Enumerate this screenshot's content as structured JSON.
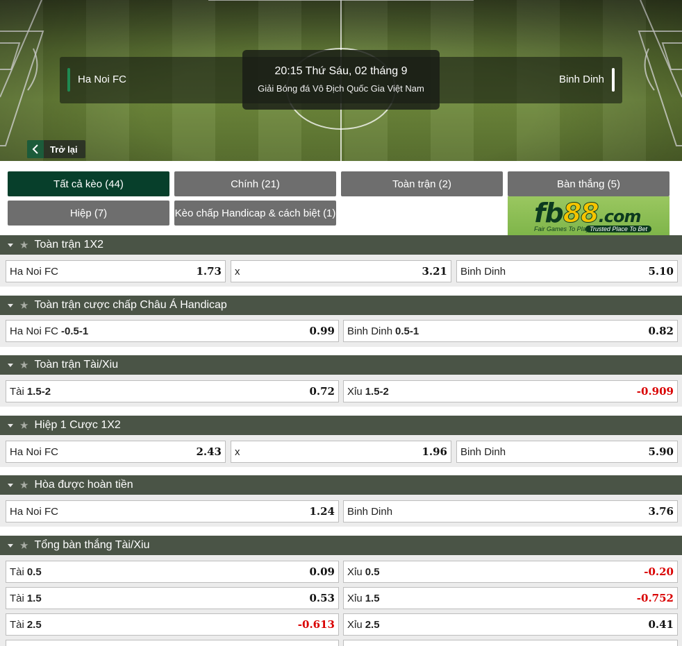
{
  "match": {
    "home_team": "Ha Noi FC",
    "away_team": "Binh Dinh",
    "datetime": "20:15 Thứ Sáu, 02 tháng 9",
    "league": "Giải Bóng đá Vô Địch Quốc Gia Việt Nam",
    "back_label": "Trở lại"
  },
  "filters": [
    {
      "label": "Tất cả kèo (44)",
      "active": true
    },
    {
      "label": "Chính (21)",
      "active": false
    },
    {
      "label": "Toàn trận (2)",
      "active": false
    },
    {
      "label": "Bàn thắng (5)",
      "active": false
    },
    {
      "label": "Hiệp (7)",
      "active": false
    },
    {
      "label": "Kèo chấp Handicap & cách biệt (1)",
      "active": false
    }
  ],
  "ad": {
    "brand_a": "fb",
    "brand_b": "88",
    "brand_c": ".com",
    "tagline_a": "Fair Games To Play",
    "tagline_b": "Trusted Place To Bet"
  },
  "markets": [
    {
      "title": "Toàn trận 1X2",
      "rows": [
        [
          {
            "label": "Ha Noi FC",
            "line": "",
            "odd": "1.73"
          },
          {
            "label": "x",
            "line": "",
            "odd": "3.21"
          },
          {
            "label": "Binh Dinh",
            "line": "",
            "odd": "5.10"
          }
        ]
      ]
    },
    {
      "title": "Toàn trận cược chấp Châu Á Handicap",
      "rows": [
        [
          {
            "label": "Ha Noi FC",
            "line": "-0.5-1",
            "odd": "0.99"
          },
          {
            "label": "Binh Dinh",
            "line": "0.5-1",
            "odd": "0.82"
          }
        ]
      ]
    },
    {
      "title": "Toàn trận Tài/Xiu",
      "rows": [
        [
          {
            "label": "Tài",
            "line": "1.5-2",
            "odd": "0.72"
          },
          {
            "label": "Xỉu",
            "line": "1.5-2",
            "odd": "-0.909"
          }
        ]
      ]
    },
    {
      "title": "Hiệp 1 Cược 1X2",
      "rows": [
        [
          {
            "label": "Ha Noi FC",
            "line": "",
            "odd": "2.43"
          },
          {
            "label": "x",
            "line": "",
            "odd": "1.96"
          },
          {
            "label": "Binh Dinh",
            "line": "",
            "odd": "5.90"
          }
        ]
      ]
    },
    {
      "title": "Hòa được hoàn tiền",
      "rows": [
        [
          {
            "label": "Ha Noi FC",
            "line": "",
            "odd": "1.24"
          },
          {
            "label": "Binh Dinh",
            "line": "",
            "odd": "3.76"
          }
        ]
      ]
    },
    {
      "title": "Tổng bàn thắng Tài/Xiu",
      "rows": [
        [
          {
            "label": "Tài",
            "line": "0.5",
            "odd": "0.09"
          },
          {
            "label": "Xỉu",
            "line": "0.5",
            "odd": "-0.20"
          }
        ],
        [
          {
            "label": "Tài",
            "line": "1.5",
            "odd": "0.53"
          },
          {
            "label": "Xỉu",
            "line": "1.5",
            "odd": "-0.752"
          }
        ],
        [
          {
            "label": "Tài",
            "line": "2.5",
            "odd": "-0.613"
          },
          {
            "label": "Xỉu",
            "line": "2.5",
            "odd": "0.41"
          }
        ]
      ]
    }
  ]
}
